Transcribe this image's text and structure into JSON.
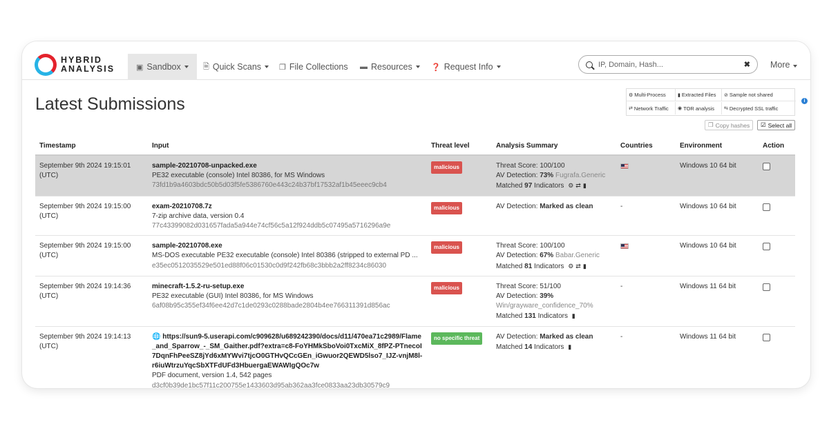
{
  "brand": {
    "line1": "HYBRID",
    "line2": "ANALYSIS"
  },
  "nav": {
    "sandbox": "Sandbox",
    "quick_scans": "Quick Scans",
    "file_collections": "File Collections",
    "resources": "Resources",
    "request_info": "Request Info",
    "more": "More"
  },
  "search": {
    "placeholder": "IP, Domain, Hash...",
    "value": ""
  },
  "page": {
    "title": "Latest Submissions"
  },
  "legend": {
    "multi_process": "Multi-Process",
    "extracted_files": "Extracted Files",
    "sample_not_shared": "Sample not shared",
    "network_traffic": "Network Traffic",
    "tor_analysis": "TOR analysis",
    "decrypted_ssl": "Decrypted SSL traffic"
  },
  "actions": {
    "copy_hashes": "Copy hashes",
    "select_all": "Select all"
  },
  "table": {
    "headers": {
      "timestamp": "Timestamp",
      "input": "Input",
      "threat": "Threat level",
      "analysis": "Analysis Summary",
      "countries": "Countries",
      "environment": "Environment",
      "action": "Action"
    },
    "rows": [
      {
        "ts1": "September 9th 2024 19:15:01",
        "ts2": "(UTC)",
        "name": "sample-20210708-unpacked.exe",
        "desc": "PE32 executable (console) Intel 80386, for MS Windows",
        "hash": "73fd1b9a4603bdc50b5d03f5fe5386760e443c24b37bf17532af1b45eeec9cb4",
        "threat": "malicious",
        "score": "Threat Score: 100/100",
        "av_label": "AV Detection: ",
        "av_pct": "73%",
        "av_family": "Fugrafa.Generic",
        "matched_pre": "Matched ",
        "matched_num": "97",
        "matched_post": " Indicators",
        "environment": "Windows 10 64 bit"
      },
      {
        "ts1": "September 9th 2024 19:15:00",
        "ts2": "(UTC)",
        "name": "exam-20210708.7z",
        "desc": "7-zip archive data, version 0.4",
        "hash": "77c43399082d031657fada5a944e74cf56c5a12f924ddb5c07495a5716296a9e",
        "threat": "malicious",
        "av_label": "AV Detection: ",
        "av_clean": "Marked as clean",
        "countries": "-",
        "environment": "Windows 10 64 bit"
      },
      {
        "ts1": "September 9th 2024 19:15:00",
        "ts2": "(UTC)",
        "name": "sample-20210708.exe",
        "desc": "MS-DOS executable PE32 executable (console) Intel 80386 (stripped to external PD ...",
        "hash": "e35ec0512035529e501ed88f06c01530c0d9f242fb68c3bbb2a2ff8234c86030",
        "threat": "malicious",
        "score": "Threat Score: 100/100",
        "av_label": "AV Detection: ",
        "av_pct": "67%",
        "av_family": "Babar.Generic",
        "matched_pre": "Matched ",
        "matched_num": "81",
        "matched_post": " Indicators",
        "environment": "Windows 10 64 bit"
      },
      {
        "ts1": "September 9th 2024 19:14:36",
        "ts2": "(UTC)",
        "name": "minecraft-1.5.2-ru-setup.exe",
        "desc": "PE32 executable (GUI) Intel 80386, for MS Windows",
        "hash": "6af08b95c355ef34f6ee42d7c1de0293c0288bade2804b4ee766311391d856ac",
        "threat": "malicious",
        "score": "Threat Score: 51/100",
        "av_label": "AV Detection: ",
        "av_pct": "39%",
        "av_family": "Win/grayware_confidence_70%",
        "matched_pre": "Matched ",
        "matched_num": "131",
        "matched_post": " Indicators",
        "countries": "-",
        "environment": "Windows 11 64 bit"
      },
      {
        "ts1": "September 9th 2024 19:14:13",
        "ts2": "(UTC)",
        "url": "https://sun9-5.userapi.com/c909628/u689242390/docs/d11/470ea71c2989/Flame_and_Sparrow_-_SM_Gaither.pdf?extra=c8-FoYHMkSboVoi0TxcMiX_8fPZ-PTnecoI7DqnFhPeeSZ8jYd6xMYWvi7tjcO0GTHvQCcGEn_iGwuor2QEWD5lso7_IJZ-vnjM8l-r6iuWtrzuYqcSbXTFdUFd3HbuergaEWAWIgQOc7w",
        "desc": "PDF document, version 1.4, 542 pages",
        "hash": "d3cf0b39de1bc57f11c200755e1433603d95ab362aa3fce0833aa23db30579c9",
        "threat": "no specific threat",
        "av_label": "AV Detection: ",
        "av_clean": "Marked as clean",
        "matched_pre": "Matched ",
        "matched_num": "14",
        "matched_post": " Indicators",
        "countries": "-",
        "environment": "Windows 11 64 bit"
      }
    ]
  }
}
